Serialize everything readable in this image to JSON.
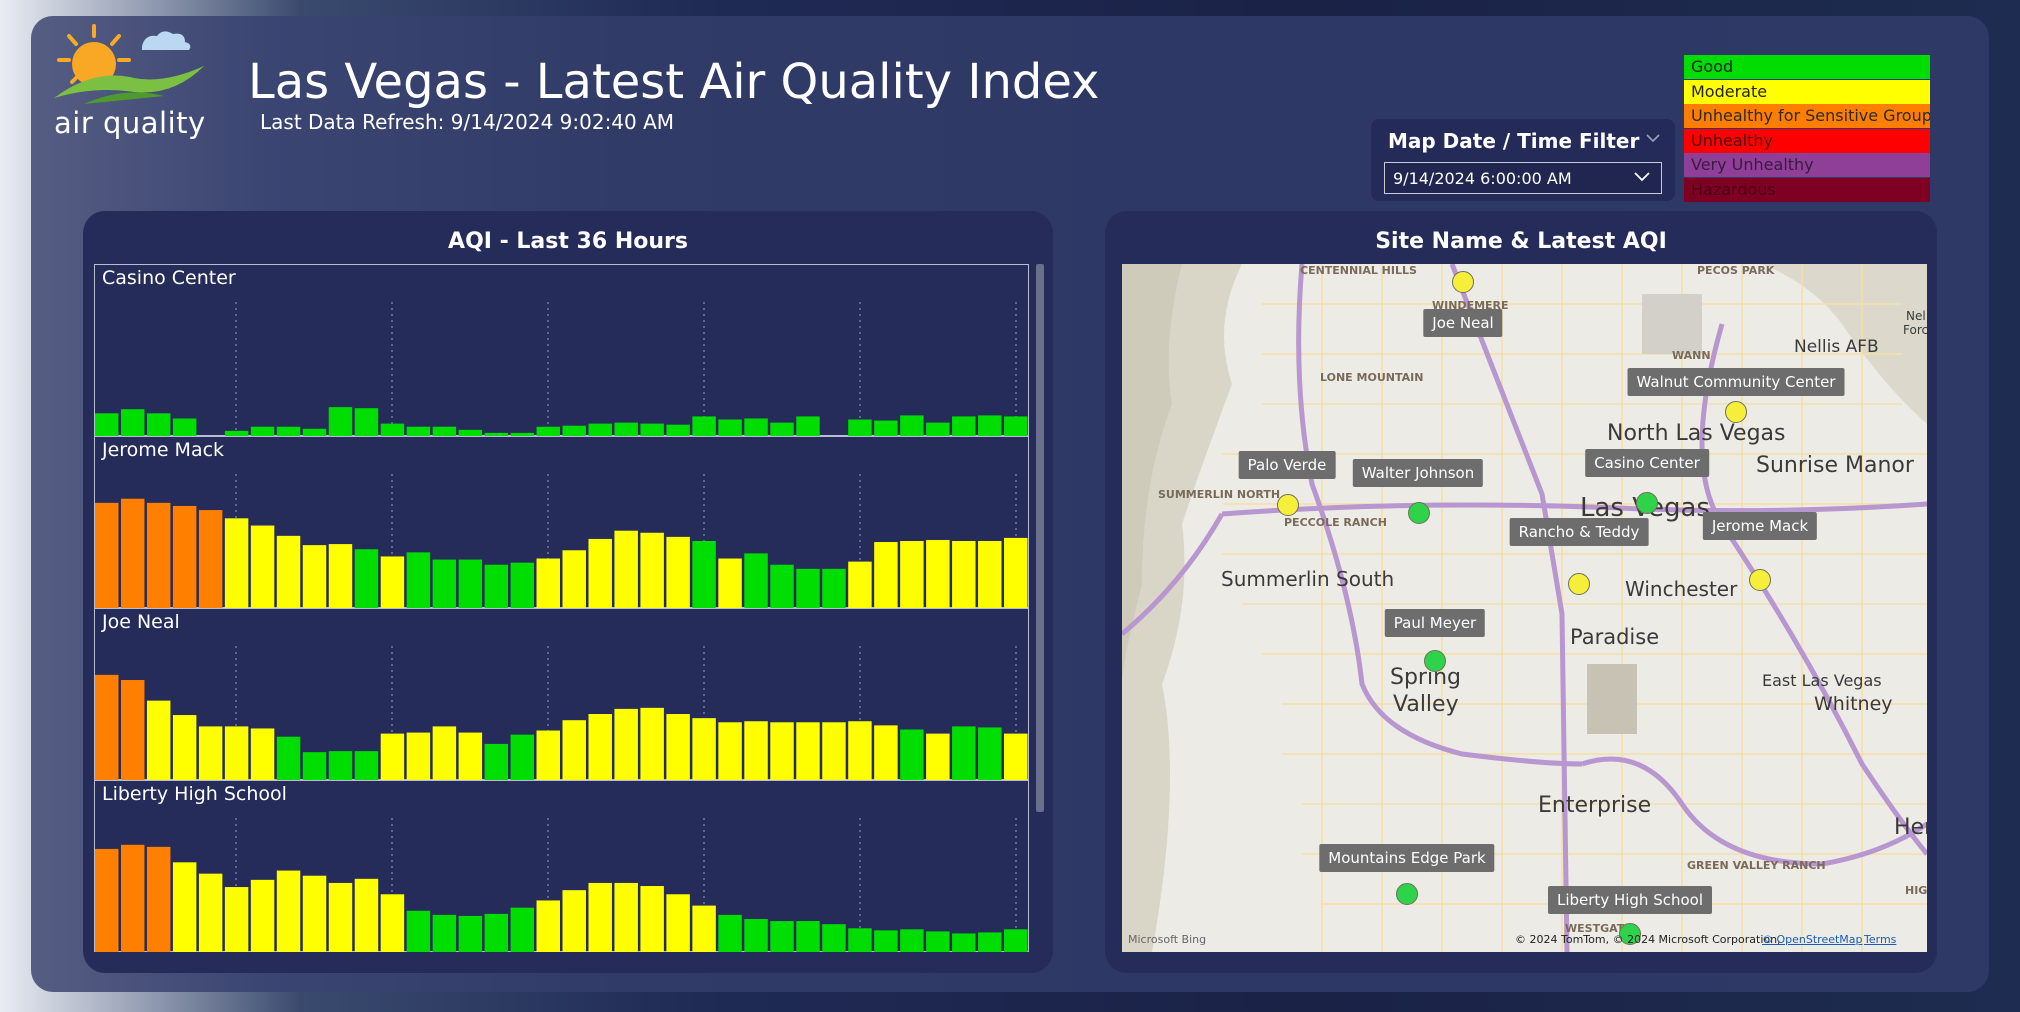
{
  "header": {
    "logo_text": "air quality",
    "title": "Las Vegas - Latest Air Quality Index",
    "refresh": "Last Data Refresh: 9/14/2024 9:02:40 AM"
  },
  "filter": {
    "title": "Map Date / Time Filter",
    "selected": "9/14/2024 6:00:00 AM"
  },
  "legend": [
    {
      "label": "Good",
      "color": "#00dd00"
    },
    {
      "label": "Moderate",
      "color": "#ffff00"
    },
    {
      "label": "Unhealthy for Sensitive Groups",
      "color": "#ff7e00"
    },
    {
      "label": "Unhealthy",
      "color": "#ff0000"
    },
    {
      "label": "Very Unhealthy",
      "color": "#8f3f97"
    },
    {
      "label": "Hazardous",
      "color": "#7e0023"
    }
  ],
  "left_panel": {
    "title": "AQI - Last 36 Hours"
  },
  "right_panel": {
    "title": "Site Name & Latest AQI"
  },
  "chart_data": [
    {
      "type": "bar",
      "title": "Casino Center",
      "ylim": [
        0,
        130
      ],
      "values": [
        22,
        26,
        22,
        17,
        0,
        5,
        9,
        9,
        7,
        28,
        27,
        12,
        9,
        9,
        6,
        3,
        3,
        9,
        10,
        12,
        13,
        12,
        11,
        19,
        16,
        17,
        13,
        19,
        0,
        16,
        15,
        20,
        13,
        19,
        20,
        19
      ],
      "colors": [
        "g",
        "g",
        "g",
        "g",
        "g",
        "g",
        "g",
        "g",
        "g",
        "g",
        "g",
        "g",
        "g",
        "g",
        "g",
        "g",
        "g",
        "g",
        "g",
        "g",
        "g",
        "g",
        "g",
        "g",
        "g",
        "g",
        "g",
        "g",
        "g",
        "g",
        "g",
        "g",
        "g",
        "g",
        "g",
        "g"
      ]
    },
    {
      "type": "bar",
      "title": "Jerome Mack",
      "ylim": [
        0,
        130
      ],
      "values": [
        102,
        106,
        102,
        99,
        95,
        87,
        80,
        70,
        61,
        62,
        57,
        50,
        54,
        47,
        47,
        42,
        44,
        48,
        56,
        67,
        75,
        73,
        69,
        65,
        48,
        53,
        42,
        38,
        38,
        45,
        64,
        65,
        66,
        65,
        65,
        68,
        68
      ],
      "colors": [
        "o",
        "o",
        "o",
        "o",
        "o",
        "y",
        "y",
        "y",
        "y",
        "y",
        "g",
        "y",
        "g",
        "g",
        "g",
        "g",
        "g",
        "y",
        "y",
        "y",
        "y",
        "y",
        "y",
        "g",
        "y",
        "g",
        "g",
        "g",
        "g",
        "y",
        "y",
        "y",
        "y",
        "y",
        "y",
        "y"
      ]
    },
    {
      "type": "bar",
      "title": "Joe Neal",
      "ylim": [
        0,
        130
      ],
      "values": [
        102,
        97,
        77,
        63,
        52,
        52,
        50,
        42,
        27,
        28,
        28,
        45,
        46,
        52,
        46,
        35,
        44,
        48,
        58,
        64,
        69,
        70,
        64,
        60,
        56,
        57,
        56,
        56,
        56,
        57,
        53,
        49,
        45,
        52,
        51,
        45,
        54
      ],
      "colors": [
        "o",
        "o",
        "y",
        "y",
        "y",
        "y",
        "y",
        "g",
        "g",
        "g",
        "g",
        "y",
        "y",
        "y",
        "y",
        "g",
        "g",
        "y",
        "y",
        "y",
        "y",
        "y",
        "y",
        "y",
        "y",
        "y",
        "y",
        "y",
        "y",
        "y",
        "y",
        "g",
        "y",
        "g",
        "g",
        "y",
        "g",
        "y"
      ]
    },
    {
      "type": "bar",
      "title": "Liberty High School",
      "ylim": [
        0,
        130
      ],
      "values": [
        100,
        104,
        102,
        87,
        76,
        63,
        70,
        79,
        74,
        67,
        71,
        56,
        40,
        36,
        35,
        37,
        43,
        50,
        60,
        67,
        67,
        64,
        56,
        45,
        36,
        32,
        30,
        30,
        27,
        23,
        21,
        22,
        20,
        18,
        19,
        22,
        27
      ],
      "colors": [
        "o",
        "o",
        "o",
        "y",
        "y",
        "y",
        "y",
        "y",
        "y",
        "y",
        "y",
        "y",
        "g",
        "g",
        "g",
        "g",
        "g",
        "y",
        "y",
        "y",
        "y",
        "y",
        "y",
        "y",
        "g",
        "g",
        "g",
        "g",
        "g",
        "g",
        "g",
        "g",
        "g",
        "g",
        "g",
        "g",
        "g"
      ]
    }
  ],
  "map": {
    "labels": [
      "CENTENNIAL HILLS",
      "WINDEMERE",
      "PECOS PARK",
      "Nellis AFB",
      "LONE MOUNTAIN",
      "WANN",
      "North Las Vegas",
      "Sunrise Manor",
      "SUMMERLIN NORTH",
      "PECCOLE RANCH",
      "Las Vegas",
      "Summerlin South",
      "Winchester",
      "Paradise",
      "Spring",
      "Valley",
      "East Las Vegas",
      "Whitney",
      "Enterprise",
      "GREEN VALLEY RANCH",
      "Hen",
      "Nel",
      "Forc",
      "HIG",
      "WESTGATE"
    ],
    "markers": [
      {
        "name": "Joe Neal",
        "level": "y"
      },
      {
        "name": "Walnut Community Center",
        "level": "y"
      },
      {
        "name": "Palo Verde",
        "level": "y"
      },
      {
        "name": "Walter Johnson",
        "level": "g"
      },
      {
        "name": "Casino Center",
        "level": "g"
      },
      {
        "name": "Rancho & Teddy",
        "level": "y"
      },
      {
        "name": "Jerome Mack",
        "level": "y"
      },
      {
        "name": "Paul Meyer",
        "level": "g"
      },
      {
        "name": "Mountains Edge Park",
        "level": "g"
      },
      {
        "name": "Liberty High School",
        "level": "g"
      }
    ],
    "attribution": "© 2024 TomTom, © 2024 Microsoft Corporation,",
    "osm_link": "© OpenStreetMap",
    "terms_link": "Terms",
    "bing": "Microsoft Bing"
  },
  "icons": {
    "chevron": "chevron-down-icon",
    "dropdown": "dropdown-arrow-icon",
    "sun": "sun-logo-icon"
  }
}
